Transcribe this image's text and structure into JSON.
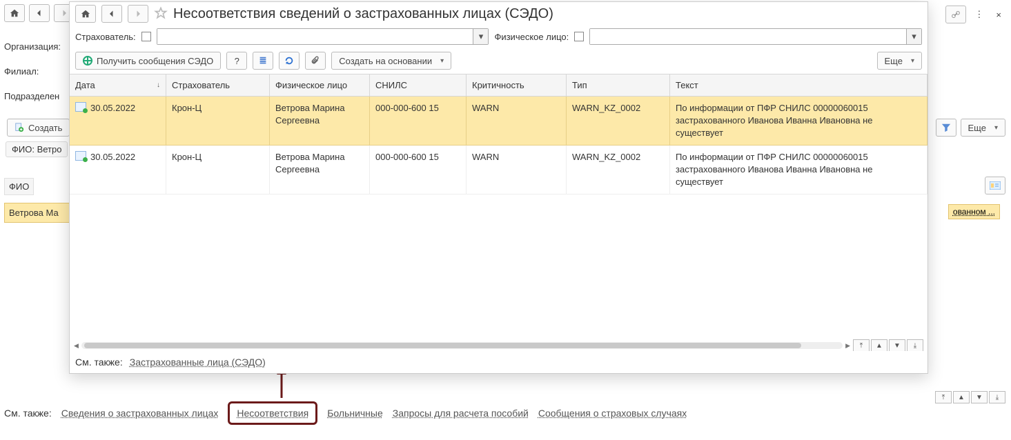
{
  "bg": {
    "labels": {
      "organization": "Организация:",
      "filial": "Филиал:",
      "subdivision": "Подразделен"
    },
    "create": "Создать",
    "fio_prefix": "ФИО: Ветро",
    "col_fio": "ФИО",
    "row_sel": "Ветрова Ма",
    "more": "Еще",
    "right_link_trunc": "ованном ...",
    "see_also": {
      "label": "См. также:",
      "links": [
        "Сведения о застрахованных лицах",
        "Несоответствия",
        "Больничные",
        "Запросы для расчета пособий",
        "Сообщения о страховых случаях"
      ]
    }
  },
  "modal": {
    "title": "Несоответствия сведений о застрахованных лицах (СЭДО)",
    "filters": {
      "strah_label": "Страхователь:",
      "fiz_label": "Физическое лицо:"
    },
    "toolbar": {
      "get_msgs": "Получить сообщения СЭДО",
      "help": "?",
      "create_based": "Создать на основании",
      "more": "Еще"
    },
    "columns": {
      "date": "Дата",
      "strah": "Страхователь",
      "fiz": "Физическое лицо",
      "snils": "СНИЛС",
      "crit": "Критичность",
      "type": "Тип",
      "text": "Текст"
    },
    "rows": [
      {
        "date": "30.05.2022",
        "strah": "Крон-Ц",
        "fiz": "Ветрова Марина Сергеевна",
        "snils": "000-000-600 15",
        "crit": "WARN",
        "type": "WARN_KZ_0002",
        "text": "По информации от ПФР СНИЛС 00000060015 застрахованного Иванова Иванна Ивановна не существует"
      },
      {
        "date": "30.05.2022",
        "strah": "Крон-Ц",
        "fiz": "Ветрова Марина Сергеевна",
        "snils": "000-000-600 15",
        "crit": "WARN",
        "type": "WARN_KZ_0002",
        "text": "По информации от ПФР СНИЛС 00000060015 застрахованного Иванова Иванна Ивановна не существует"
      }
    ],
    "footer": {
      "see_also": "См. также:",
      "link": "Застрахованные лица (СЭДО)"
    }
  },
  "nav_glyphs": {
    "first": "⤒",
    "up": "▲",
    "down": "▼",
    "last": "⤓"
  }
}
